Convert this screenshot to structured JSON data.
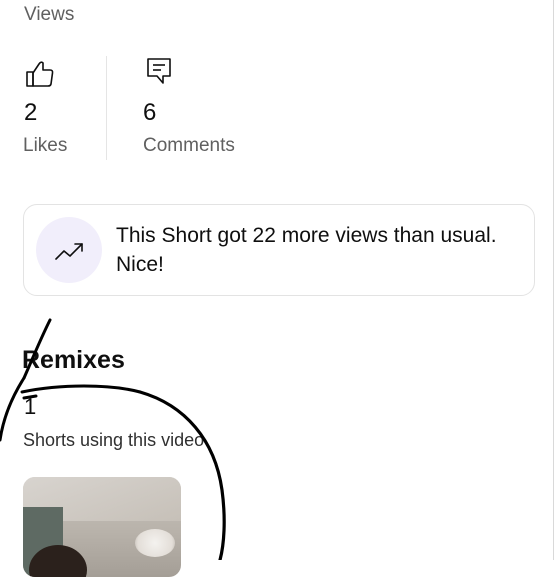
{
  "header": {
    "views_label": "Views"
  },
  "stats": [
    {
      "icon": "thumbs-up-icon",
      "value": "2",
      "label": "Likes"
    },
    {
      "icon": "comment-icon",
      "value": "6",
      "label": "Comments"
    }
  ],
  "insight": {
    "icon": "trending-up-icon",
    "text": "This Short got 22 more views than usual. Nice!"
  },
  "remixes": {
    "title": "Remixes",
    "count": "1",
    "caption": "Shorts using this video"
  },
  "colors": {
    "text_primary": "#0f0f0f",
    "text_secondary": "#606060",
    "insight_badge_bg": "#f1eefb",
    "card_border": "#e3e3e3",
    "scribble": "#000000"
  }
}
